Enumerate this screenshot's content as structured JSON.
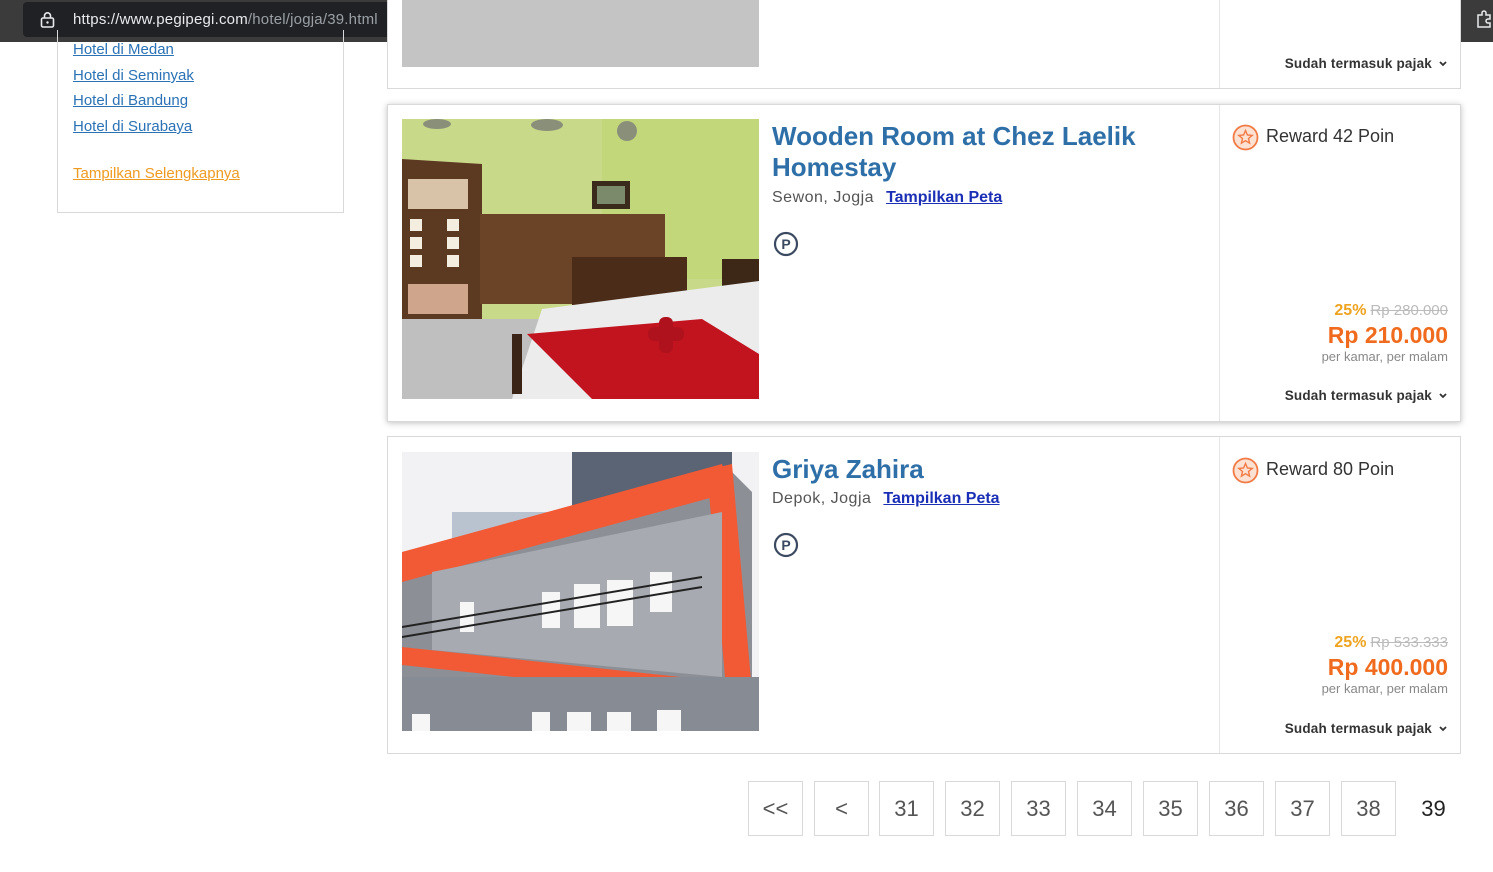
{
  "browser": {
    "url_host": "https://www.pegipegi.com",
    "url_path": "/hotel/jogja/39.html"
  },
  "sidebar": {
    "links": [
      "Hotel di Medan",
      "Hotel di Seminyak",
      "Hotel di Bandung",
      "Hotel di Surabaya"
    ],
    "more_label": "Tampilkan Selengkapnya"
  },
  "previous_card": {
    "tax_label": "Sudah termasuk pajak"
  },
  "hotels": [
    {
      "name": "Wooden Room at Chez Laelik Homestay",
      "location": "Sewon, Jogja",
      "map_label": "Tampilkan Peta",
      "facility_icon": "parking-icon",
      "reward": "Reward 42 Poin",
      "discount": "25%",
      "original_price": "Rp 280.000",
      "price": "Rp 210.000",
      "price_unit": "per kamar, per malam",
      "tax_label": "Sudah termasuk pajak"
    },
    {
      "name": "Griya Zahira",
      "location": "Depok, Jogja",
      "map_label": "Tampilkan Peta",
      "facility_icon": "parking-icon",
      "reward": "Reward 80 Poin",
      "discount": "25%",
      "original_price": "Rp 533.333",
      "price": "Rp 400.000",
      "price_unit": "per kamar, per malam",
      "tax_label": "Sudah termasuk pajak"
    }
  ],
  "pagination": {
    "first": "<<",
    "prev": "<",
    "pages": [
      "31",
      "32",
      "33",
      "34",
      "35",
      "36",
      "37",
      "38"
    ],
    "current": "39"
  },
  "colors": {
    "link_blue": "#2e6fa8",
    "price_orange": "#f06b1d",
    "discount_yellow": "#efa31f",
    "more_link_orange": "#ef9b21"
  }
}
